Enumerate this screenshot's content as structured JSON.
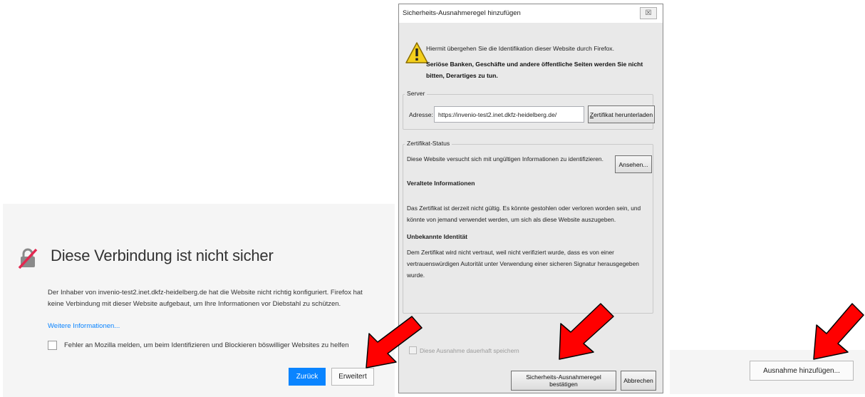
{
  "left_page": {
    "title": "Diese Verbindung ist nicht sicher",
    "description": "Der Inhaber von invenio-test2.inet.dkfz-heidelberg.de hat die Website nicht richtig konfiguriert. Firefox hat keine Verbindung mit dieser Website aufgebaut, um Ihre Informationen vor Diebstahl zu schützen.",
    "more_info_link": "Weitere Informationen...",
    "report_checkbox_label": "Fehler an Mozilla melden, um beim Identifizieren und Blockieren böswilliger Websites zu helfen",
    "back_button": "Zurück",
    "advanced_button": "Erweitert",
    "accent_color": "#0a84ff",
    "icon": "broken-lock-icon"
  },
  "dialog": {
    "title": "Sicherheits-Ausnahmeregel hinzufügen",
    "close_glyph": "☒",
    "warning_icon": "warning-triangle-icon",
    "warning_line1": "Hiermit übergehen Sie die Identifikation dieser Website durch Firefox.",
    "warning_line2": "Seriöse Banken, Geschäfte und andere öffentliche Seiten werden Sie nicht bitten, Derartiges zu tun.",
    "server": {
      "legend": "Server",
      "address_label": "Adresse:",
      "address_value": "https://invenio-test2.inet.dkfz-heidelberg.de/",
      "download_button_u": "Z",
      "download_button_rest": "ertifikat herunterladen"
    },
    "status": {
      "legend": "Zertifikat-Status",
      "text": "Diese Website versucht sich mit ungültigen Informationen zu identifizieren.",
      "view_button": "Ansehen...",
      "outdated_title": "Veraltete Informationen",
      "outdated_text": "Das Zertifikat ist derzeit nicht gültig. Es könnte gestohlen oder verloren worden sein, und könnte von jemand verwendet werden, um sich als diese Website auszugeben.",
      "unknown_title": "Unbekannte Identität",
      "unknown_text": "Dem Zertifikat wird nicht vertraut, weil nicht verifiziert wurde, dass es von einer vertrauenswürdigen Autorität unter Verwendung einer sicheren Signatur herausgegeben wurde."
    },
    "permanent_label": "Diese Ausnahme dauerhaft speichern",
    "confirm_button": "Sicherheits-Ausnahmeregel bestätigen",
    "cancel_button": "Abbrechen"
  },
  "right_panel": {
    "add_exception_button": "Ausnahme hinzufügen..."
  },
  "colors": {
    "arrow_fill": "#ff0000",
    "arrow_stroke": "#000000",
    "warning_yellow": "#f4cf1c"
  }
}
